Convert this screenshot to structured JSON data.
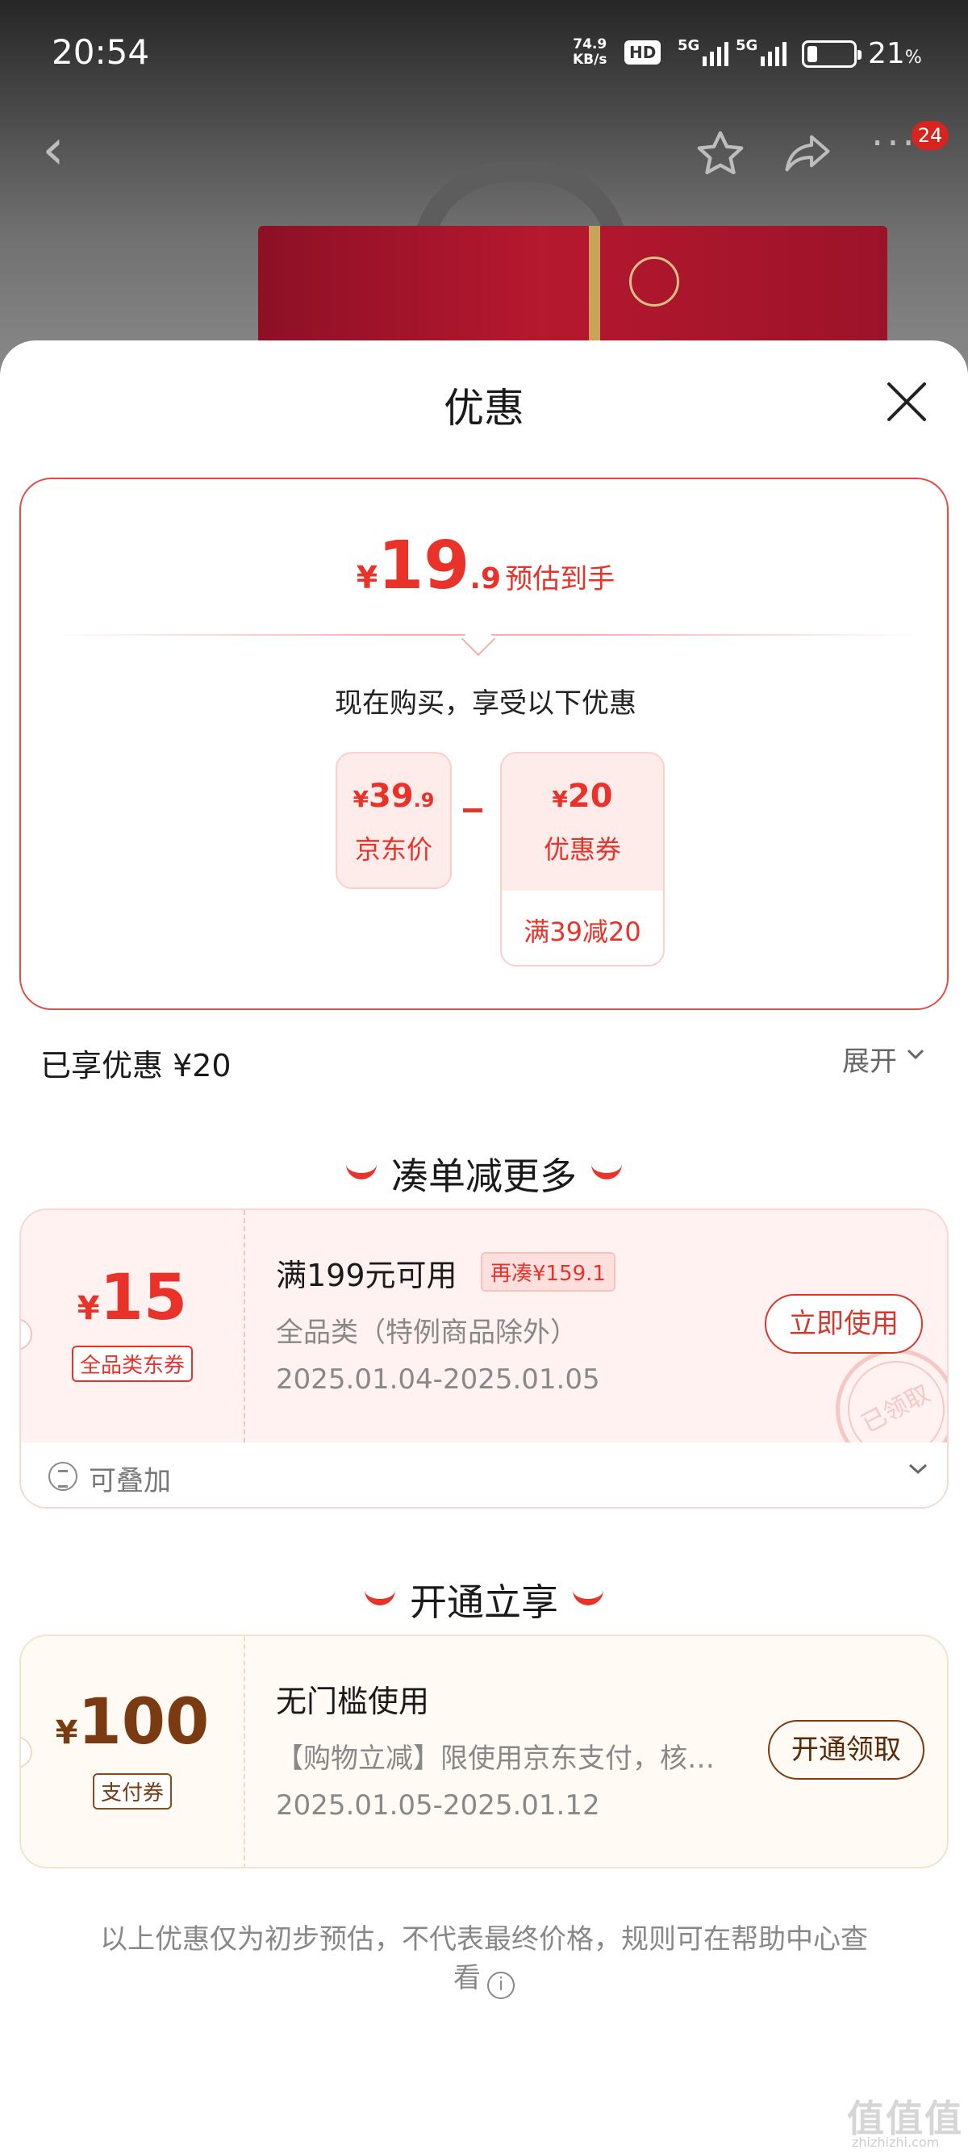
{
  "status_bar": {
    "time": "20:54",
    "net_speed_value": "74.9",
    "net_speed_unit": "KB/s",
    "hd_label": "HD",
    "signal1_label": "5G",
    "signal2_label": "5G",
    "battery_percent": "21",
    "battery_unit": "%"
  },
  "nav": {
    "more_badge": "24"
  },
  "sheet": {
    "title": "优惠"
  },
  "estimate": {
    "currency": "¥",
    "price_int": "19",
    "price_dec": ".9",
    "label": "预估到手",
    "now_buy_text": "现在购买，享受以下优惠",
    "jd_price": {
      "currency": "¥",
      "int": "39",
      "dec": ".9",
      "label": "京东价"
    },
    "coupon": {
      "currency": "¥",
      "value": "20",
      "label": "优惠券",
      "condition": "满39减20"
    }
  },
  "enjoyed": {
    "text": "已享优惠 ¥20",
    "expand_label": "展开"
  },
  "section_combine": {
    "title": "凑单减更多"
  },
  "coupon_combine": {
    "currency": "¥",
    "amount": "15",
    "tag": "全品类东券",
    "condition": "满199元可用",
    "extra": "再凑¥159.1",
    "scope": "全品类（特例商品除外）",
    "date_range": "2025.01.04-2025.01.05",
    "button": "立即使用",
    "stamp": "已领取",
    "stack_label": "可叠加"
  },
  "section_open": {
    "title": "开通立享"
  },
  "coupon_open": {
    "currency": "¥",
    "amount": "100",
    "tag": "支付券",
    "condition": "无门槛使用",
    "scope": "【购物立减】限使用京东支付，核…",
    "date_range": "2025.01.05-2025.01.12",
    "button": "开通领取"
  },
  "disclaimer": {
    "text": "以上优惠仅为初步预估，不代表最终价格，规则可在帮助中心查看"
  },
  "watermark": {
    "text": "值值值",
    "url": "zhizhizhi.com"
  },
  "colors": {
    "accent": "#e8322a",
    "coupon_brown": "#7a3b12"
  }
}
